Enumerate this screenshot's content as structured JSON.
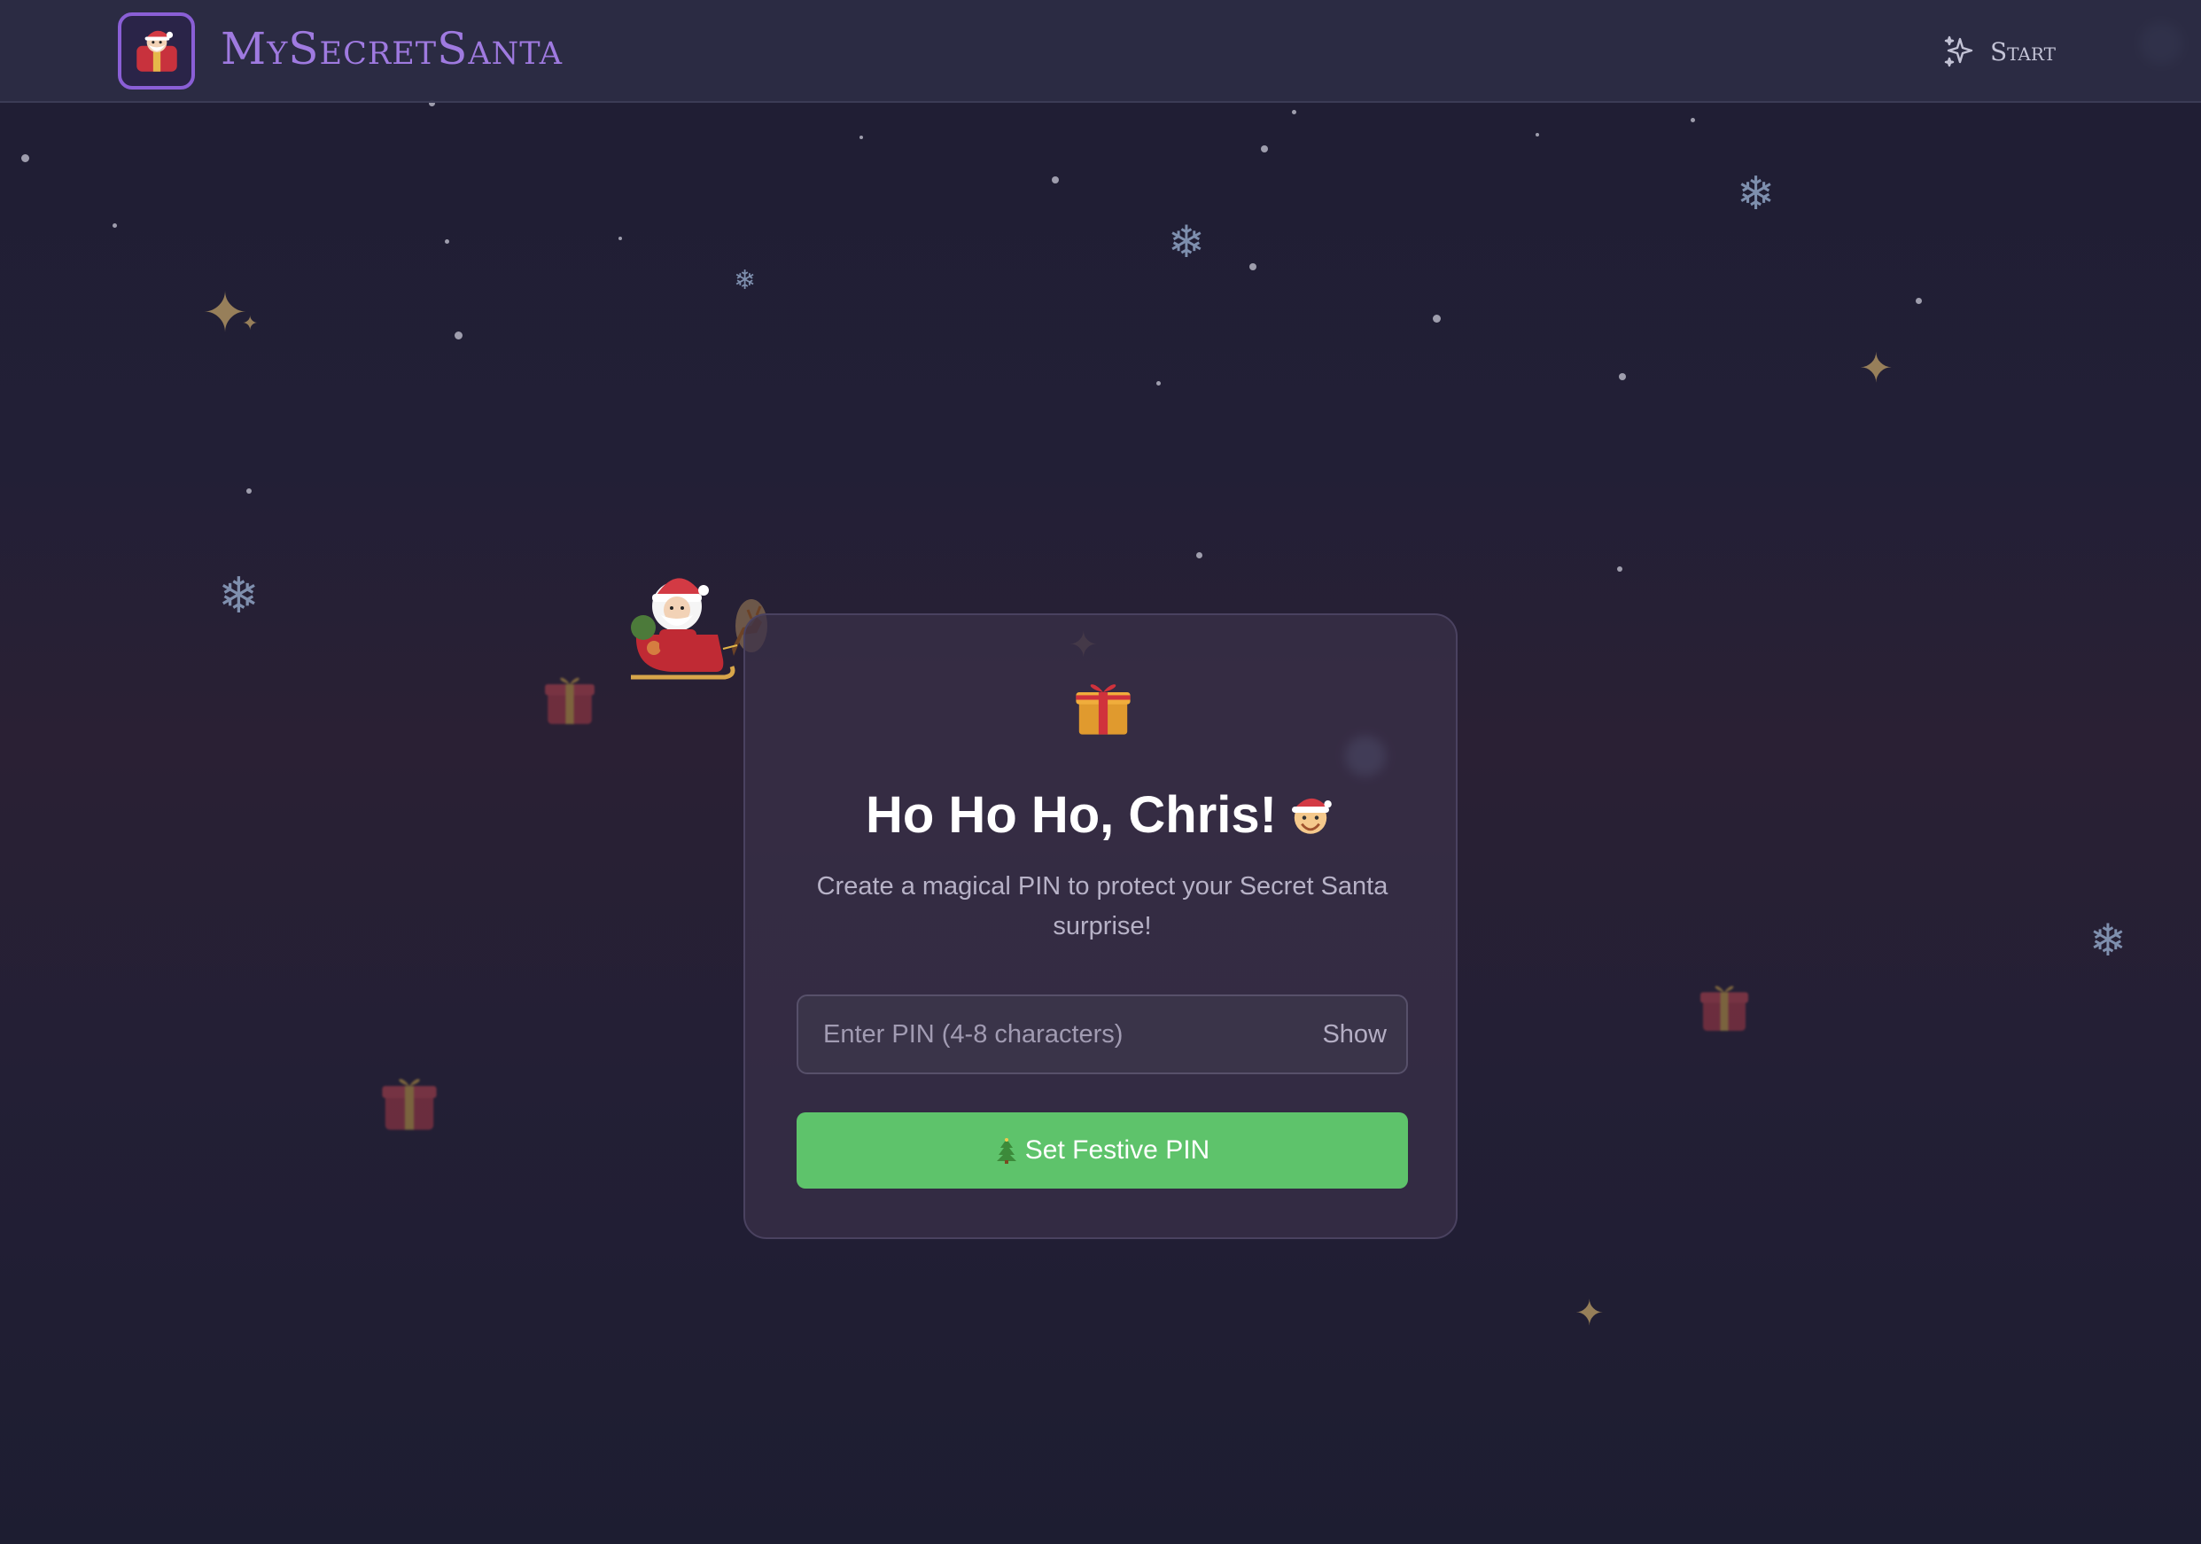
{
  "header": {
    "brand": "MySecretSanta",
    "start_label": "Start",
    "start_icon": "sparkles-icon",
    "logo_icon": "santa-logo-icon"
  },
  "card": {
    "top_icon": "gift-icon",
    "title": "Ho Ho Ho, Chris!",
    "title_emoji": "santa-face-icon",
    "subtitle": "Create a magical PIN to protect your Secret Santa surprise!",
    "pin_placeholder": "Enter PIN (4-8 characters)",
    "pin_value": "",
    "show_label": "Show",
    "submit_label": "Set Festive PIN",
    "submit_icon": "christmas-tree-icon"
  },
  "colors": {
    "brand": "#9f7ae0",
    "accent_green": "#5ec36b",
    "background": "#221f36"
  }
}
